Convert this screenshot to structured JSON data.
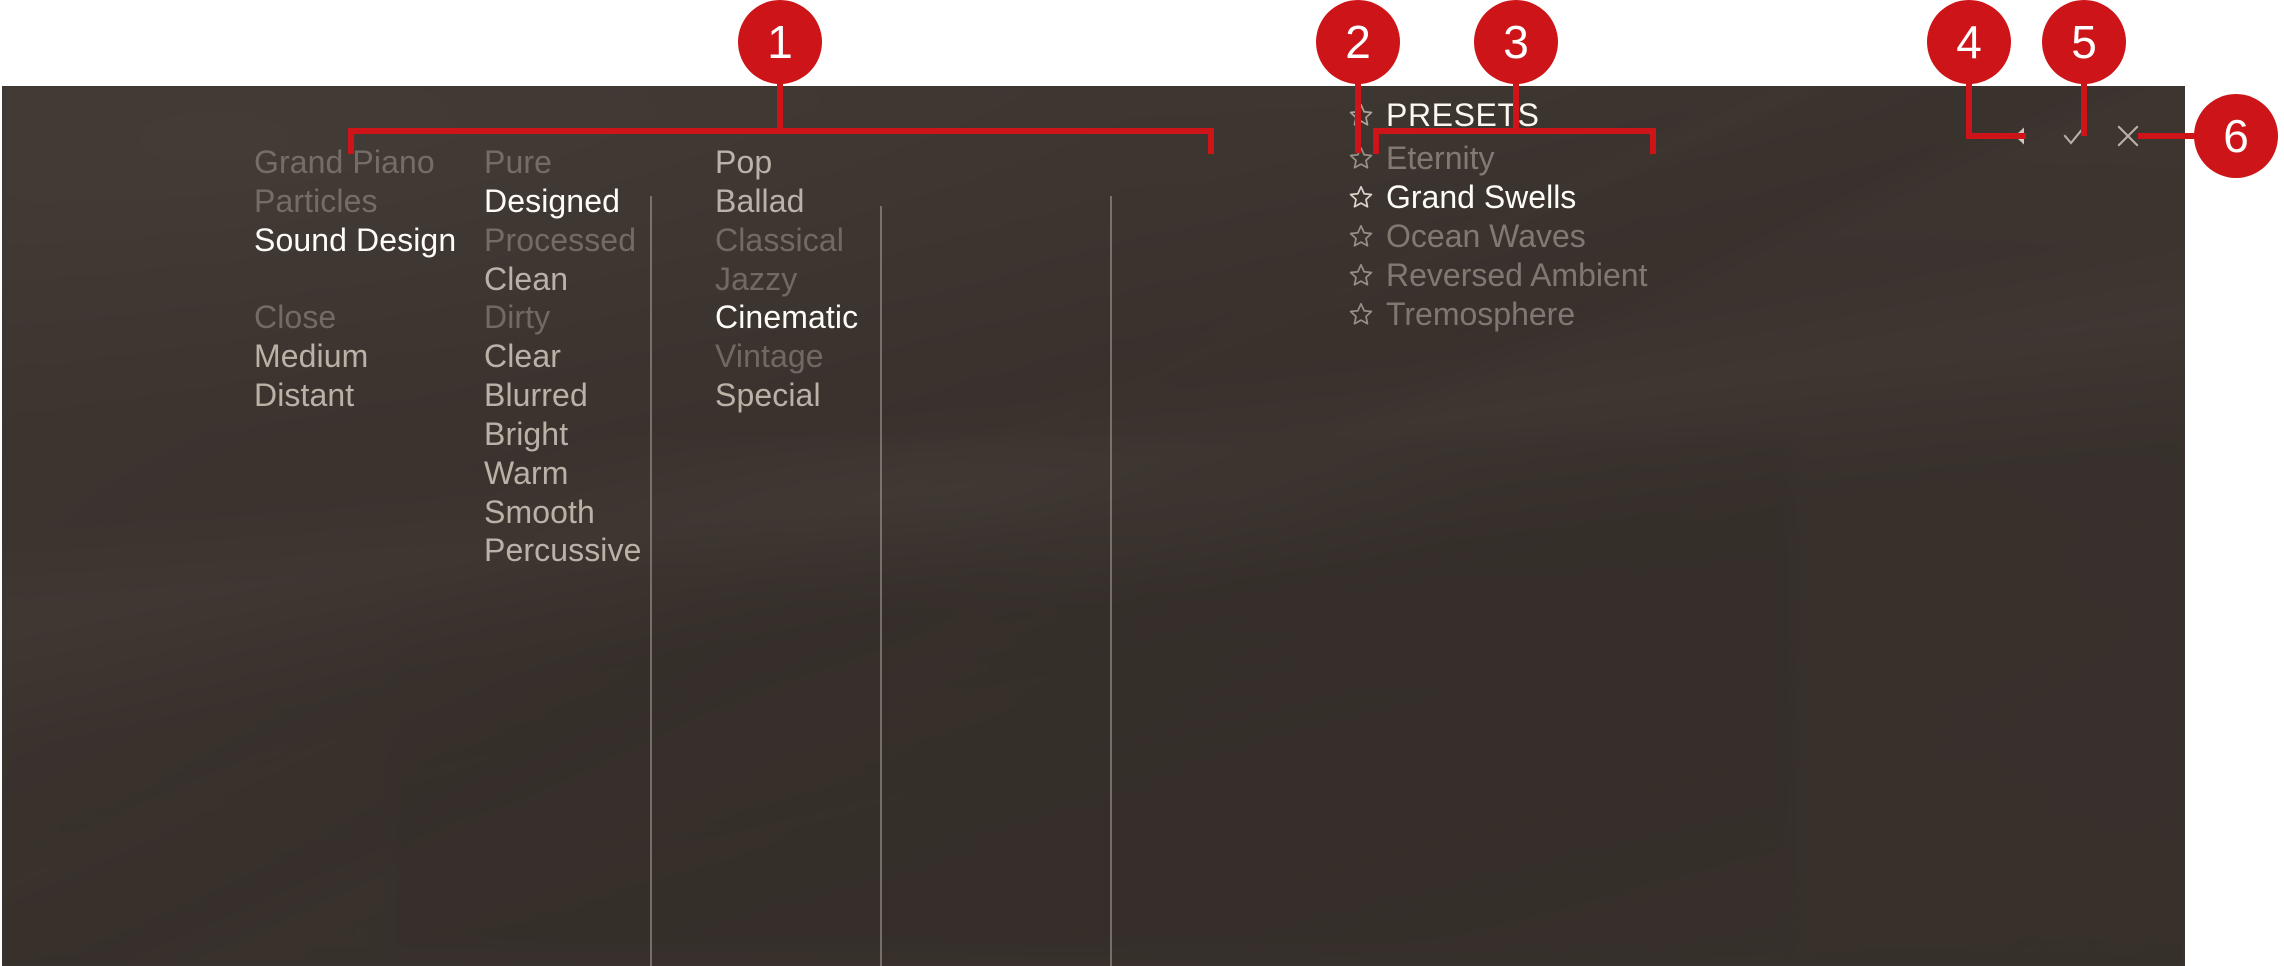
{
  "app": {
    "panel_name": "preset-browser",
    "background_color": "#413b36",
    "accent_color": "#cc1419",
    "selected_text_color": "#fefcf8"
  },
  "columns": [
    {
      "name": "instrument-and-mic-column",
      "groups": [
        {
          "name": "instrument-group",
          "items": [
            {
              "label": "Grand Piano",
              "state": "dim"
            },
            {
              "label": "Particles",
              "state": "dim"
            },
            {
              "label": "Sound Design",
              "state": "selected"
            }
          ]
        },
        {
          "name": "mic-position-group",
          "items": [
            {
              "label": "Close",
              "state": "dim"
            },
            {
              "label": "Medium",
              "state": "normal"
            },
            {
              "label": "Distant",
              "state": "normal"
            }
          ]
        }
      ]
    },
    {
      "name": "character-column",
      "groups": [
        {
          "name": "character-group",
          "items": [
            {
              "label": "Pure",
              "state": "dim"
            },
            {
              "label": "Designed",
              "state": "selected"
            },
            {
              "label": "Processed",
              "state": "dim"
            },
            {
              "label": "Clean",
              "state": "normal"
            },
            {
              "label": "Dirty",
              "state": "dim"
            },
            {
              "label": "Clear",
              "state": "normal"
            },
            {
              "label": "Blurred",
              "state": "normal"
            },
            {
              "label": "Bright",
              "state": "normal"
            },
            {
              "label": "Warm",
              "state": "normal"
            },
            {
              "label": "Smooth",
              "state": "normal"
            },
            {
              "label": "Percussive",
              "state": "normal"
            }
          ]
        }
      ]
    },
    {
      "name": "genre-column",
      "groups": [
        {
          "name": "genre-group",
          "items": [
            {
              "label": "Pop",
              "state": "normal"
            },
            {
              "label": "Ballad",
              "state": "normal"
            },
            {
              "label": "Classical",
              "state": "dim"
            },
            {
              "label": "Jazzy",
              "state": "dim"
            },
            {
              "label": "Cinematic",
              "state": "selected"
            },
            {
              "label": "Vintage",
              "state": "dim"
            },
            {
              "label": "Special",
              "state": "normal"
            }
          ]
        }
      ]
    }
  ],
  "presets": {
    "name": "presets-column",
    "header": {
      "label": "PRESETS",
      "icon": "star-outline-icon"
    },
    "items": [
      {
        "label": "Eternity",
        "state": "dim",
        "icon": "star-outline-icon"
      },
      {
        "label": "Grand Swells",
        "state": "selected",
        "icon": "star-outline-icon"
      },
      {
        "label": "Ocean Waves",
        "state": "dim",
        "icon": "star-outline-icon"
      },
      {
        "label": "Reversed Ambient",
        "state": "dim",
        "icon": "star-outline-icon"
      },
      {
        "label": "Tremosphere",
        "state": "dim",
        "icon": "star-outline-icon"
      }
    ]
  },
  "header_actions": [
    {
      "name": "audition-preview-button",
      "icon": "speaker-icon",
      "label": ""
    },
    {
      "name": "confirm-button",
      "icon": "checkmark-icon",
      "label": ""
    },
    {
      "name": "close-button",
      "icon": "close-x-icon",
      "label": ""
    }
  ],
  "callouts": [
    {
      "number": "1",
      "target": "browser-category-columns"
    },
    {
      "number": "2",
      "target": "favorites-star-toggle"
    },
    {
      "number": "3",
      "target": "presets-list"
    },
    {
      "number": "4",
      "target": "audition-preview-button"
    },
    {
      "number": "5",
      "target": "confirm-button"
    },
    {
      "number": "6",
      "target": "close-button"
    }
  ]
}
